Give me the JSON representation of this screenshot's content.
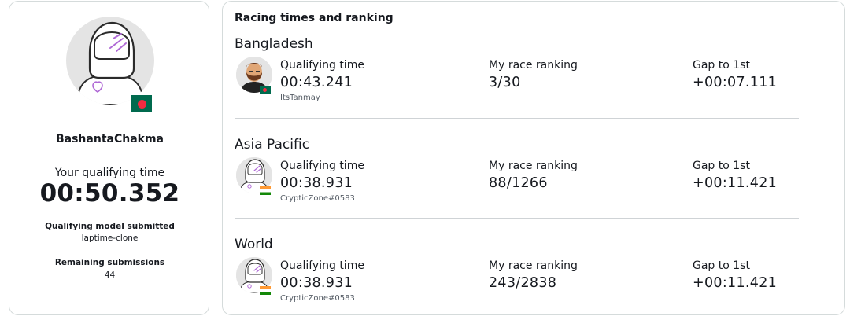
{
  "profile": {
    "username": "BashantaChakma",
    "qualifying_label": "Your qualifying time",
    "qualifying_time": "00:50.352",
    "model_label": "Qualifying model submitted",
    "model_name": "laptime-clone",
    "remaining_label": "Remaining submissions",
    "remaining_value": "44",
    "flag": "bangladesh-flag"
  },
  "ranking": {
    "title": "Racing times and ranking",
    "sections": [
      {
        "name": "Bangladesh",
        "qualifying_label": "Qualifying time",
        "qualifying_time": "00:43.241",
        "leader": "ItsTanmay",
        "leader_flag": "bangladesh-flag",
        "ranking_label": "My race ranking",
        "ranking": "3/30",
        "gap_label": "Gap to 1st",
        "gap": "+00:07.111"
      },
      {
        "name": "Asia Pacific",
        "qualifying_label": "Qualifying time",
        "qualifying_time": "00:38.931",
        "leader": "CrypticZone#0583",
        "leader_flag": "india-flag",
        "ranking_label": "My race ranking",
        "ranking": "88/1266",
        "gap_label": "Gap to 1st",
        "gap": "+00:11.421"
      },
      {
        "name": "World",
        "qualifying_label": "Qualifying time",
        "qualifying_time": "00:38.931",
        "leader": "CrypticZone#0583",
        "leader_flag": "india-flag",
        "ranking_label": "My race ranking",
        "ranking": "243/2838",
        "gap_label": "Gap to 1st",
        "gap": "+00:11.421"
      }
    ]
  },
  "colors": {
    "helmet_accent": "#b06ad6",
    "divider": "#cfd3d6",
    "card_border": "#d5dbdb"
  }
}
